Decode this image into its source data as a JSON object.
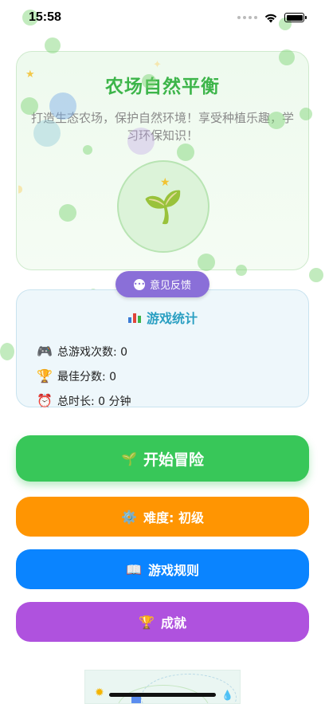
{
  "status_bar": {
    "time": "15:58"
  },
  "hero": {
    "title": "农场自然平衡",
    "subtitle": "打造生态农场，保护自然环境！享受种植乐趣，学习环保知识！",
    "icon": "seedling-icon"
  },
  "feedback": {
    "label": "意见反馈",
    "icon": "speech-bubble-icon"
  },
  "stats": {
    "title": "游戏统计",
    "icon": "bar-chart-icon",
    "rows": [
      {
        "icon": "🎮",
        "label": "总游戏次数: 0"
      },
      {
        "icon": "🏆",
        "label": "最佳分数: 0"
      },
      {
        "icon": "⏰",
        "label": "总时长: 0 分钟"
      }
    ]
  },
  "buttons": {
    "start": {
      "icon": "🌱",
      "label": "开始冒险"
    },
    "difficulty": {
      "icon": "⚙️",
      "label": "难度: 初级"
    },
    "rules": {
      "icon": "📖",
      "label": "游戏规则"
    },
    "achievements": {
      "icon": "🏆",
      "label": "成就"
    }
  },
  "colors": {
    "title_green": "#3db54a",
    "start": "#38c759",
    "difficulty": "#ff9502",
    "rules": "#0a84ff",
    "achievements": "#af52de",
    "feedback": "#8a6fd8",
    "stats_title": "#2a9fc2"
  }
}
